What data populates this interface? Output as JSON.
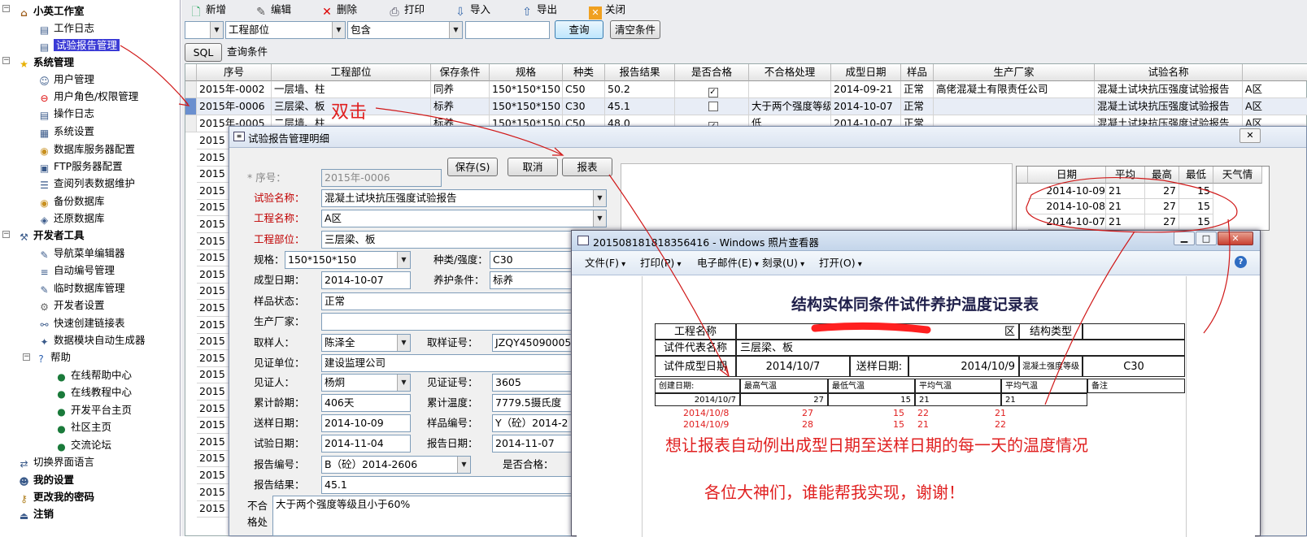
{
  "tree": {
    "items": [
      {
        "label": "小英工作室",
        "icon": "house-icon",
        "bold": true
      },
      {
        "label": "工作日志",
        "icon": "document-icon"
      },
      {
        "label": "试验报告管理",
        "icon": "document-icon",
        "selected": true
      },
      {
        "label": "系统管理",
        "icon": "star-icon",
        "bold": true
      },
      {
        "label": "用户管理",
        "icon": "users-icon"
      },
      {
        "label": "用户角色/权限管理",
        "icon": "no-entry-icon"
      },
      {
        "label": "操作日志",
        "icon": "document-icon"
      },
      {
        "label": "系统设置",
        "icon": "settings-document-icon"
      },
      {
        "label": "数据库服务器配置",
        "icon": "database-icon"
      },
      {
        "label": "FTP服务器配置",
        "icon": "ftp-icon"
      },
      {
        "label": "查阅列表数据维护",
        "icon": "list-icon"
      },
      {
        "label": "备份数据库",
        "icon": "database-icon"
      },
      {
        "label": "还原数据库",
        "icon": "database-edit-icon"
      },
      {
        "label": "开发者工具",
        "icon": "tools-icon",
        "bold": true
      },
      {
        "label": "导航菜单编辑器",
        "icon": "edit-icon"
      },
      {
        "label": "自动编号管理",
        "icon": "numbered-list-icon"
      },
      {
        "label": "临时数据库管理",
        "icon": "edit-icon"
      },
      {
        "label": "开发者设置",
        "icon": "gear-icon"
      },
      {
        "label": "快速创建链接表",
        "icon": "link-icon"
      },
      {
        "label": "数据模块自动生成器",
        "icon": "wand-icon"
      },
      {
        "label": "帮助",
        "icon": "help-icon"
      },
      {
        "label": "在线帮助中心",
        "icon": "globe-icon"
      },
      {
        "label": "在线教程中心",
        "icon": "globe-icon"
      },
      {
        "label": "开发平台主页",
        "icon": "globe-icon"
      },
      {
        "label": "社区主页",
        "icon": "globe-icon"
      },
      {
        "label": "交流论坛",
        "icon": "globe-icon"
      },
      {
        "label": "切换界面语言",
        "icon": "language-icon"
      },
      {
        "label": "我的设置",
        "icon": "user-settings-icon",
        "bold": true
      },
      {
        "label": "更改我的密码",
        "icon": "key-icon",
        "bold": true
      },
      {
        "label": "注销",
        "icon": "logout-icon",
        "bold": true
      }
    ]
  },
  "toolbar": {
    "new": "新增",
    "edit": "编辑",
    "delete": "删除",
    "print": "打印",
    "import": "导入",
    "export": "导出",
    "close": "关闭"
  },
  "filter": {
    "field": "工程部位",
    "op": "包含",
    "value": "",
    "query": "查询",
    "clear": "清空条件",
    "sql": "SQL",
    "sql_label": "查询条件"
  },
  "grid": {
    "columns": [
      "序号",
      "工程部位",
      "保存条件",
      "规格",
      "种类",
      "报告结果",
      "是否合格",
      "不合格处理",
      "成型日期",
      "样品",
      "生产厂家",
      "试验名称",
      ""
    ],
    "rows": [
      [
        "2015年-0002",
        "一层墙、柱",
        "同养",
        "150*150*150",
        "C50",
        "50.2",
        "checked",
        "",
        "2014-09-21",
        "正常",
        "高佬混凝土有限责任公司",
        "混凝土试块抗压强度试验报告",
        "A区"
      ],
      [
        "2015年-0006",
        "三层梁、板",
        "标养",
        "150*150*150",
        "C30",
        "45.1",
        "unchecked",
        "大于两个强度等级",
        "2014-10-07",
        "正常",
        "",
        "混凝土试块抗压强度试验报告",
        "A区"
      ],
      [
        "2015年-0005",
        "二层墙、柱",
        "标养",
        "150*150*150",
        "C50",
        "48.0",
        "checked",
        "低",
        "2014-10-07",
        "正常",
        "",
        "混凝土试块抗压强度试验报告",
        "A区"
      ]
    ],
    "left_stub": "2015"
  },
  "detail": {
    "title": "试验报告管理明细",
    "buttons": {
      "save": "保存(S)",
      "cancel": "取消",
      "report": "报表"
    },
    "fields": {
      "seq_label": "* 序号：",
      "seq": "2015年-0006",
      "test_name_label": "试验名称：",
      "test_name": "混凝土试块抗压强度试验报告",
      "project_label": "工程名称：",
      "project": "A区",
      "part_label": "工程部位：",
      "part": "三层梁、板",
      "spec_label": "规格：",
      "spec": "150*150*150",
      "type_label": "种类/强度：",
      "type": "C30",
      "form_date_label": "成型日期：",
      "form_date": "2014-10-07",
      "cure_label": "养护条件：",
      "cure": "标养",
      "sample_state_label": "样品状态：",
      "sample_state": "正常",
      "maker_label": "生产厂家：",
      "maker": "",
      "sampler_label": "取样人：",
      "sampler": "陈泽全",
      "sample_cert_label": "取样证号：",
      "sample_cert": "JZQY45090005",
      "witness_unit_label": "见证单位：",
      "witness_unit": "建设监理公司",
      "witness_label": "见证人：",
      "witness": "杨炯",
      "witness_cert_label": "见证证号：",
      "witness_cert": "3605",
      "age_label": "累计龄期：",
      "age": "406天",
      "temp_label": "累计温度：",
      "temp": "7779.5摄氏度",
      "send_date_label": "送样日期：",
      "send_date": "2014-10-09",
      "sample_no_label": "样品编号：",
      "sample_no": "Y（砼）2014-2",
      "test_date_label": "试验日期：",
      "test_date": "2014-11-04",
      "report_date_label": "报告日期：",
      "report_date": "2014-11-07",
      "report_no_label": "报告编号：",
      "report_no": "B（砼）2014-2606",
      "qualified_label": "是否合格：",
      "result_label": "报告结果：",
      "result": "45.1",
      "unq_label_1": "不合",
      "unq_label_2": "格处",
      "unq": "大于两个强度等级且小于60%"
    },
    "temp_grid": {
      "columns": [
        "日期",
        "平均",
        "最高",
        "最低",
        "天气情"
      ],
      "rows": [
        [
          "2014-10-09",
          "21",
          "27",
          "15"
        ],
        [
          "2014-10-08",
          "21",
          "27",
          "15"
        ],
        [
          "2014-10-07",
          "21",
          "27",
          "15"
        ]
      ]
    }
  },
  "viewer": {
    "title": "201508181818356416 - Windows 照片查看器",
    "menu": [
      "文件(F)",
      "打印(P)",
      "电子邮件(E)",
      "刻录(U)",
      "打开(O)"
    ],
    "doc_title": "结构实体同条件试件养护温度记录表",
    "r1": {
      "a": "工程名称",
      "b": "区",
      "c": "结构类型"
    },
    "r2": {
      "a": "试件代表名称",
      "b": "三层梁、板"
    },
    "r3": {
      "a": "试件成型日期",
      "b": "2014/10/7",
      "c": "送样日期:",
      "d": "2014/10/9",
      "e": "混凝土强度等级",
      "f": "C30"
    },
    "hdr": [
      "创建日期:",
      "最高气温",
      "最低气温",
      "平均气温",
      "平均气温",
      "备注"
    ],
    "row1": [
      "2014/10/7",
      "27",
      "15",
      "21",
      "21"
    ],
    "hw_rows": [
      [
        "2014/10/8",
        "27",
        "15",
        "22",
        "21"
      ],
      [
        "2014/10/9",
        "28",
        "15",
        "21",
        "22"
      ]
    ],
    "note1": "想让报表自动例出成型日期至送样日期的每一天的温度情况",
    "note2": "各位大神们，谁能帮我实现，谢谢！"
  },
  "annotation": {
    "dblclick": "双击"
  }
}
